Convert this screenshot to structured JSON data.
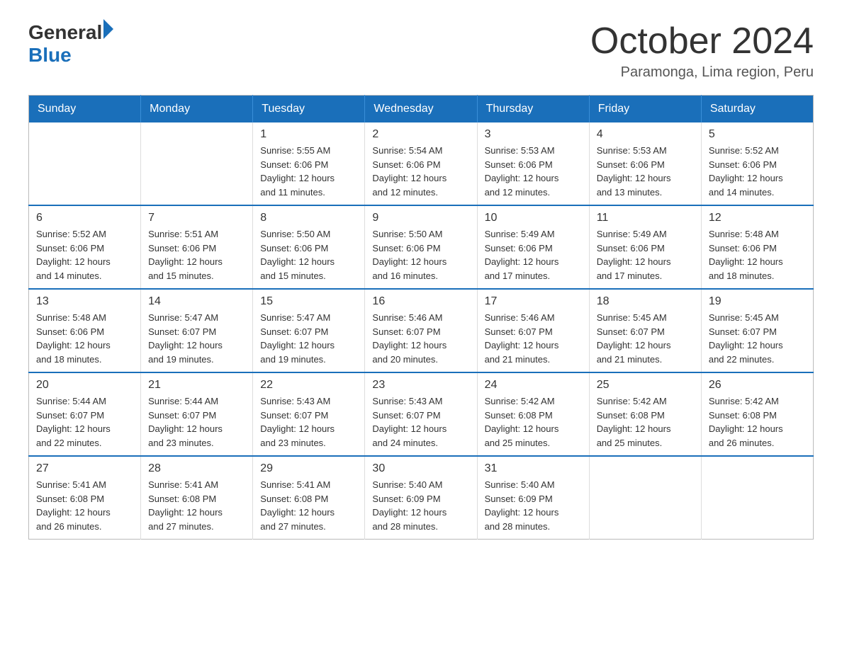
{
  "header": {
    "logo_general": "General",
    "logo_blue": "Blue",
    "month": "October 2024",
    "location": "Paramonga, Lima region, Peru"
  },
  "days_of_week": [
    "Sunday",
    "Monday",
    "Tuesday",
    "Wednesday",
    "Thursday",
    "Friday",
    "Saturday"
  ],
  "weeks": [
    [
      {
        "day": "",
        "info": ""
      },
      {
        "day": "",
        "info": ""
      },
      {
        "day": "1",
        "info": "Sunrise: 5:55 AM\nSunset: 6:06 PM\nDaylight: 12 hours\nand 11 minutes."
      },
      {
        "day": "2",
        "info": "Sunrise: 5:54 AM\nSunset: 6:06 PM\nDaylight: 12 hours\nand 12 minutes."
      },
      {
        "day": "3",
        "info": "Sunrise: 5:53 AM\nSunset: 6:06 PM\nDaylight: 12 hours\nand 12 minutes."
      },
      {
        "day": "4",
        "info": "Sunrise: 5:53 AM\nSunset: 6:06 PM\nDaylight: 12 hours\nand 13 minutes."
      },
      {
        "day": "5",
        "info": "Sunrise: 5:52 AM\nSunset: 6:06 PM\nDaylight: 12 hours\nand 14 minutes."
      }
    ],
    [
      {
        "day": "6",
        "info": "Sunrise: 5:52 AM\nSunset: 6:06 PM\nDaylight: 12 hours\nand 14 minutes."
      },
      {
        "day": "7",
        "info": "Sunrise: 5:51 AM\nSunset: 6:06 PM\nDaylight: 12 hours\nand 15 minutes."
      },
      {
        "day": "8",
        "info": "Sunrise: 5:50 AM\nSunset: 6:06 PM\nDaylight: 12 hours\nand 15 minutes."
      },
      {
        "day": "9",
        "info": "Sunrise: 5:50 AM\nSunset: 6:06 PM\nDaylight: 12 hours\nand 16 minutes."
      },
      {
        "day": "10",
        "info": "Sunrise: 5:49 AM\nSunset: 6:06 PM\nDaylight: 12 hours\nand 17 minutes."
      },
      {
        "day": "11",
        "info": "Sunrise: 5:49 AM\nSunset: 6:06 PM\nDaylight: 12 hours\nand 17 minutes."
      },
      {
        "day": "12",
        "info": "Sunrise: 5:48 AM\nSunset: 6:06 PM\nDaylight: 12 hours\nand 18 minutes."
      }
    ],
    [
      {
        "day": "13",
        "info": "Sunrise: 5:48 AM\nSunset: 6:06 PM\nDaylight: 12 hours\nand 18 minutes."
      },
      {
        "day": "14",
        "info": "Sunrise: 5:47 AM\nSunset: 6:07 PM\nDaylight: 12 hours\nand 19 minutes."
      },
      {
        "day": "15",
        "info": "Sunrise: 5:47 AM\nSunset: 6:07 PM\nDaylight: 12 hours\nand 19 minutes."
      },
      {
        "day": "16",
        "info": "Sunrise: 5:46 AM\nSunset: 6:07 PM\nDaylight: 12 hours\nand 20 minutes."
      },
      {
        "day": "17",
        "info": "Sunrise: 5:46 AM\nSunset: 6:07 PM\nDaylight: 12 hours\nand 21 minutes."
      },
      {
        "day": "18",
        "info": "Sunrise: 5:45 AM\nSunset: 6:07 PM\nDaylight: 12 hours\nand 21 minutes."
      },
      {
        "day": "19",
        "info": "Sunrise: 5:45 AM\nSunset: 6:07 PM\nDaylight: 12 hours\nand 22 minutes."
      }
    ],
    [
      {
        "day": "20",
        "info": "Sunrise: 5:44 AM\nSunset: 6:07 PM\nDaylight: 12 hours\nand 22 minutes."
      },
      {
        "day": "21",
        "info": "Sunrise: 5:44 AM\nSunset: 6:07 PM\nDaylight: 12 hours\nand 23 minutes."
      },
      {
        "day": "22",
        "info": "Sunrise: 5:43 AM\nSunset: 6:07 PM\nDaylight: 12 hours\nand 23 minutes."
      },
      {
        "day": "23",
        "info": "Sunrise: 5:43 AM\nSunset: 6:07 PM\nDaylight: 12 hours\nand 24 minutes."
      },
      {
        "day": "24",
        "info": "Sunrise: 5:42 AM\nSunset: 6:08 PM\nDaylight: 12 hours\nand 25 minutes."
      },
      {
        "day": "25",
        "info": "Sunrise: 5:42 AM\nSunset: 6:08 PM\nDaylight: 12 hours\nand 25 minutes."
      },
      {
        "day": "26",
        "info": "Sunrise: 5:42 AM\nSunset: 6:08 PM\nDaylight: 12 hours\nand 26 minutes."
      }
    ],
    [
      {
        "day": "27",
        "info": "Sunrise: 5:41 AM\nSunset: 6:08 PM\nDaylight: 12 hours\nand 26 minutes."
      },
      {
        "day": "28",
        "info": "Sunrise: 5:41 AM\nSunset: 6:08 PM\nDaylight: 12 hours\nand 27 minutes."
      },
      {
        "day": "29",
        "info": "Sunrise: 5:41 AM\nSunset: 6:08 PM\nDaylight: 12 hours\nand 27 minutes."
      },
      {
        "day": "30",
        "info": "Sunrise: 5:40 AM\nSunset: 6:09 PM\nDaylight: 12 hours\nand 28 minutes."
      },
      {
        "day": "31",
        "info": "Sunrise: 5:40 AM\nSunset: 6:09 PM\nDaylight: 12 hours\nand 28 minutes."
      },
      {
        "day": "",
        "info": ""
      },
      {
        "day": "",
        "info": ""
      }
    ]
  ]
}
